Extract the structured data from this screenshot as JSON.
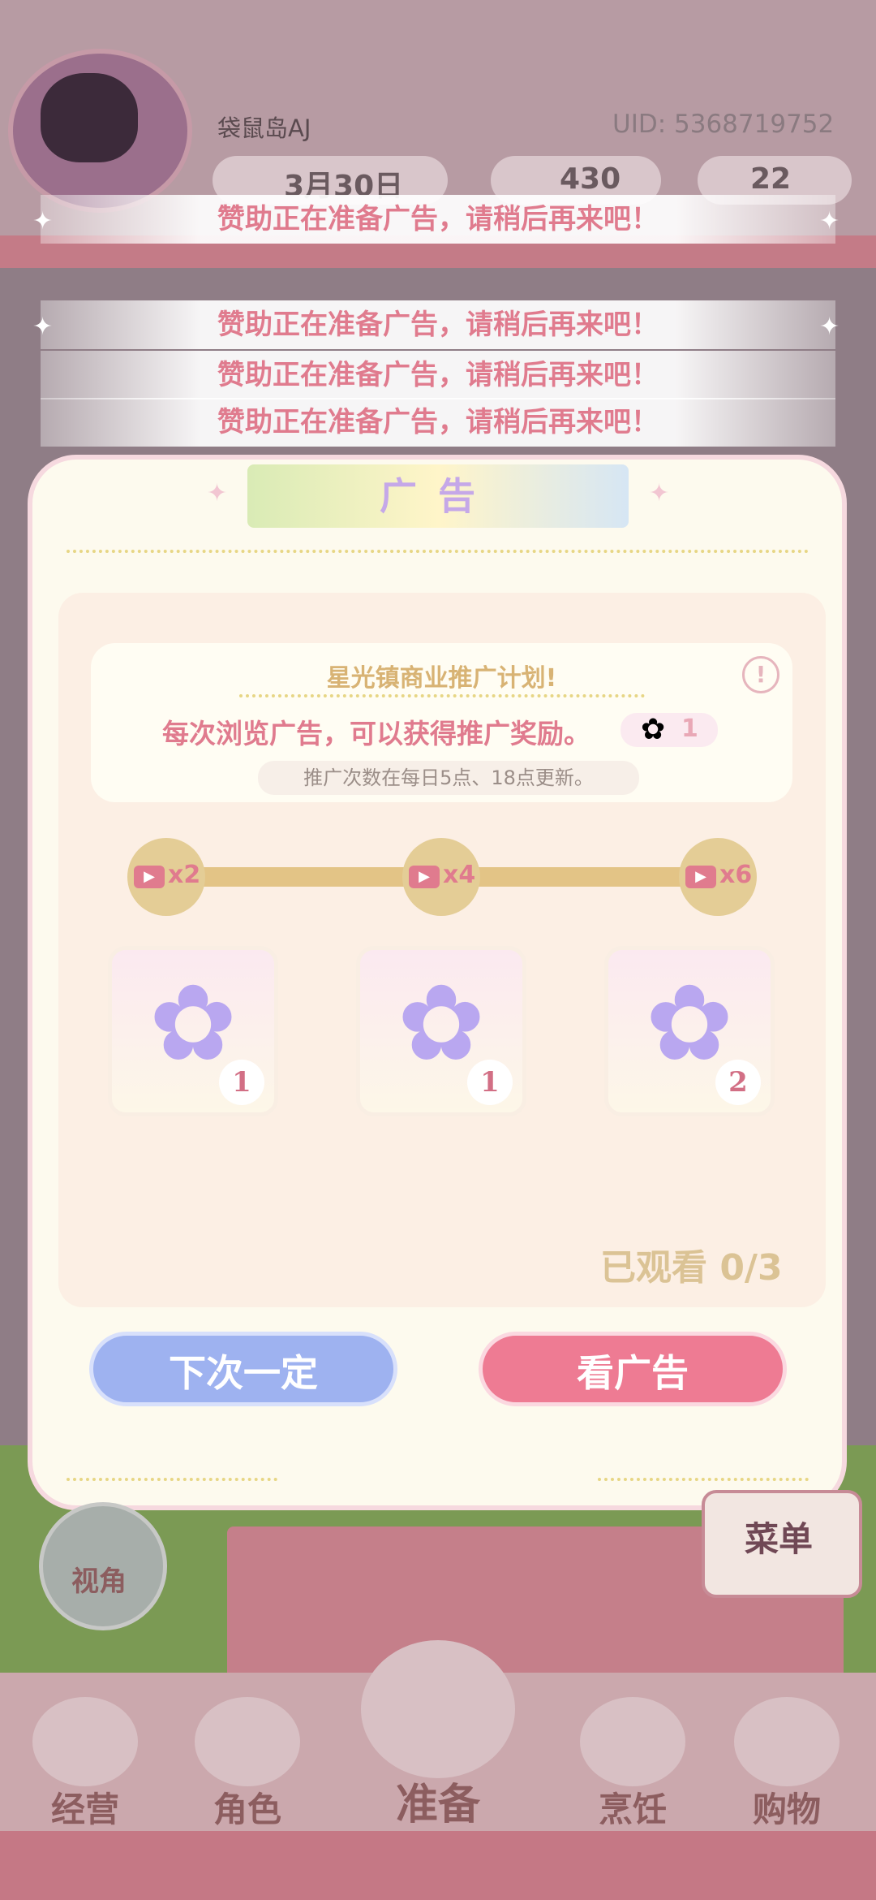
{
  "header": {
    "player_name": "袋鼠岛AJ",
    "uid": "UID: 5368719752",
    "date": "3月30日",
    "stars": "430",
    "coins": "22"
  },
  "toasts": [
    "赞助正在准备广告，请稍后再来吧！",
    "赞助正在准备广告，请稍后再来吧！",
    "赞助正在准备广告，请稍后再来吧！",
    "赞助正在准备广告，请稍后再来吧！"
  ],
  "dialog": {
    "title": "广告",
    "card_title": "星光镇商业推广计划!",
    "card_main": "每次浏览广告，可以获得推广奖励。",
    "card_reward": "1",
    "card_note": "推广次数在每日5点、18点更新。",
    "milestones": [
      {
        "label": "x2",
        "reward": "1"
      },
      {
        "label": "x4",
        "reward": "1"
      },
      {
        "label": "x6",
        "reward": "2"
      }
    ],
    "watched": "已观看 0/3",
    "btn_next": "下次一定",
    "btn_watch": "看广告"
  },
  "side": {
    "camera": "视角",
    "menu": "菜单"
  },
  "nav": {
    "items": [
      "经营",
      "角色",
      "准备",
      "烹饪",
      "购物"
    ]
  },
  "colors": {
    "accent_pink": "#ee7b93",
    "accent_blue": "#9eb2f0",
    "toast_text": "#e07b8e"
  }
}
